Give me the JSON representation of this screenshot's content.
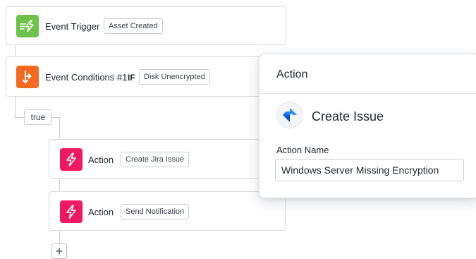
{
  "workflow": {
    "trigger": {
      "title": "Event Trigger",
      "chip": "Asset Created",
      "icon": "bolt-arrows-icon",
      "color": "#6cc24a"
    },
    "conditions": {
      "title": "Event Conditions #1",
      "if_label": "IF",
      "chip": "Disk Unencrypted",
      "icon": "branch-icon",
      "color": "#f26b21"
    },
    "branch_label": "true",
    "actions": [
      {
        "title": "Action",
        "chip": "Create Jira Issue",
        "icon": "bolt-icon",
        "color": "#f0195d"
      },
      {
        "title": "Action",
        "chip": "Send Notification",
        "icon": "bolt-icon",
        "color": "#f0195d"
      }
    ],
    "add_button": "+"
  },
  "panel": {
    "title": "Action",
    "action_name": "Create Issue",
    "action_icon": "jira-icon",
    "field_label": "Action Name",
    "field_value": "Windows Server Missing Encryption"
  }
}
